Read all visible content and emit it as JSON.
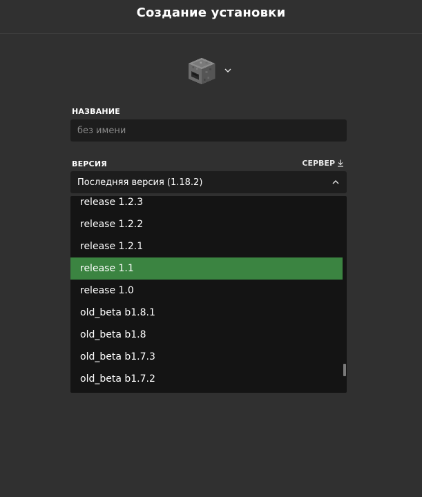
{
  "header": {
    "title": "Создание установки"
  },
  "icon_picker": {
    "icon": "furnace-icon",
    "chevron": "chevron-down-icon"
  },
  "name_field": {
    "label": "НАЗВАНИЕ",
    "value": "",
    "placeholder": "без имени"
  },
  "version_field": {
    "label": "ВЕРСИЯ",
    "server_label": "СЕРВЕР",
    "server_icon": "download-icon",
    "selected_value": "Последняя версия (1.18.2)",
    "toggle_icon": "chevron-up-icon",
    "options": [
      {
        "label": "release 1.2.3",
        "selected": false
      },
      {
        "label": "release 1.2.2",
        "selected": false
      },
      {
        "label": "release 1.2.1",
        "selected": false
      },
      {
        "label": "release 1.1",
        "selected": true
      },
      {
        "label": "release 1.0",
        "selected": false
      },
      {
        "label": "old_beta b1.8.1",
        "selected": false
      },
      {
        "label": "old_beta b1.8",
        "selected": false
      },
      {
        "label": "old_beta b1.7.3",
        "selected": false
      },
      {
        "label": "old_beta b1.7.2",
        "selected": false
      }
    ]
  },
  "colors": {
    "background": "#303030",
    "input_background": "#1d1d1d",
    "dropdown_background": "#141414",
    "highlight": "#3b8441"
  }
}
